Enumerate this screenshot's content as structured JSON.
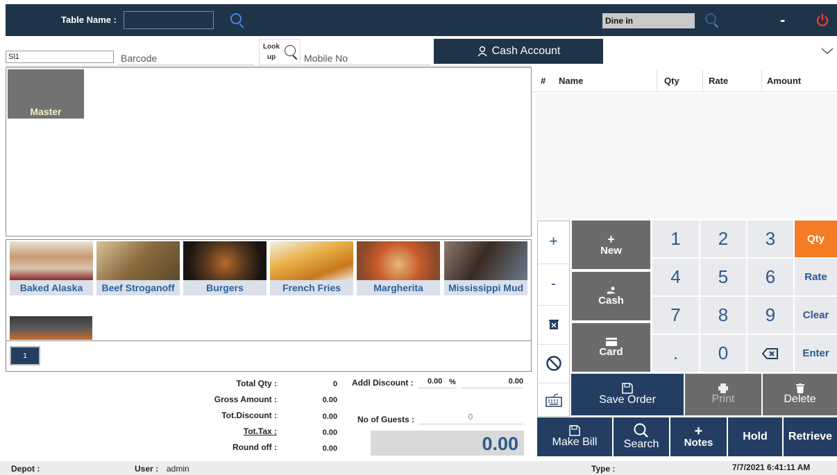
{
  "topbar": {
    "table_name_label": "Table Name :",
    "table_name_value": "",
    "order_type": "Dine in",
    "minimize_label": "-",
    "power_icon": "power-icon"
  },
  "search_row": {
    "sl_value": "Sl1",
    "barcode_placeholder": "Barcode",
    "lookup_label_1": "Look",
    "lookup_label_2": "up",
    "mobile_placeholder": "Mobile No",
    "cash_account_label": "Cash Account",
    "chevron_icon": "chevron-down-icon"
  },
  "categories": [
    {
      "label": "Master"
    }
  ],
  "dishes": [
    {
      "label": "Baked Alaska",
      "color": "#c9a07a"
    },
    {
      "label": "Beef Stroganoff",
      "color": "#8a6a3e"
    },
    {
      "label": "Burgers",
      "color": "#3a2a1e"
    },
    {
      "label": "French Fries",
      "color": "#d9952a"
    },
    {
      "label": "Margherita",
      "color": "#c86a3a"
    },
    {
      "label": "Mississippi Mud",
      "color": "#4a3a32"
    }
  ],
  "pagination": {
    "current": "1"
  },
  "order_table": {
    "headers": {
      "num": "#",
      "name": "Name",
      "qty": "Qty",
      "rate": "Rate",
      "amount": "Amount"
    }
  },
  "summary": {
    "total_qty_label": "Total Qty :",
    "total_qty": "0",
    "gross_amount_label": "Gross Amount :",
    "gross_amount": "0.00",
    "tot_discount_label": "Tot.Discount :",
    "tot_discount": "0.00",
    "tot_tax_label": "Tot.Tax :",
    "tot_tax": "0.00",
    "round_off_label": "Round off :",
    "round_off": "0.00",
    "addl_discount_label": "Addl Discount :",
    "addl_discount_pct": "0.00",
    "pct_sign": "%",
    "addl_discount_amt": "0.00",
    "guests_label": "No of Guests :",
    "guests": "0",
    "grand_total": "0.00"
  },
  "keypad": {
    "plus": "+",
    "minus": "-",
    "new_label": "New",
    "cash_label": "Cash",
    "card_label": "Card",
    "digits": [
      "1",
      "2",
      "3",
      "4",
      "5",
      "6",
      "7",
      "8",
      "9",
      ".",
      "0"
    ],
    "qty": "Qty",
    "rate": "Rate",
    "clear": "Clear",
    "enter": "Enter",
    "save_order": "Save Order",
    "print": "Print",
    "delete": "Delete",
    "make_bill": "Make Bill",
    "search": "Search",
    "notes": "Notes",
    "hold": "Hold",
    "retrieve": "Retrieve"
  },
  "status_bar": {
    "depot_label": "Depot :",
    "user_label": "User :",
    "user": "admin",
    "type_label": "Type :",
    "datetime": "7/7/2021 6:41:11 AM"
  },
  "colors": {
    "header": "#1f3349",
    "accent_orange": "#f37c25",
    "blue_button": "#233e62"
  }
}
